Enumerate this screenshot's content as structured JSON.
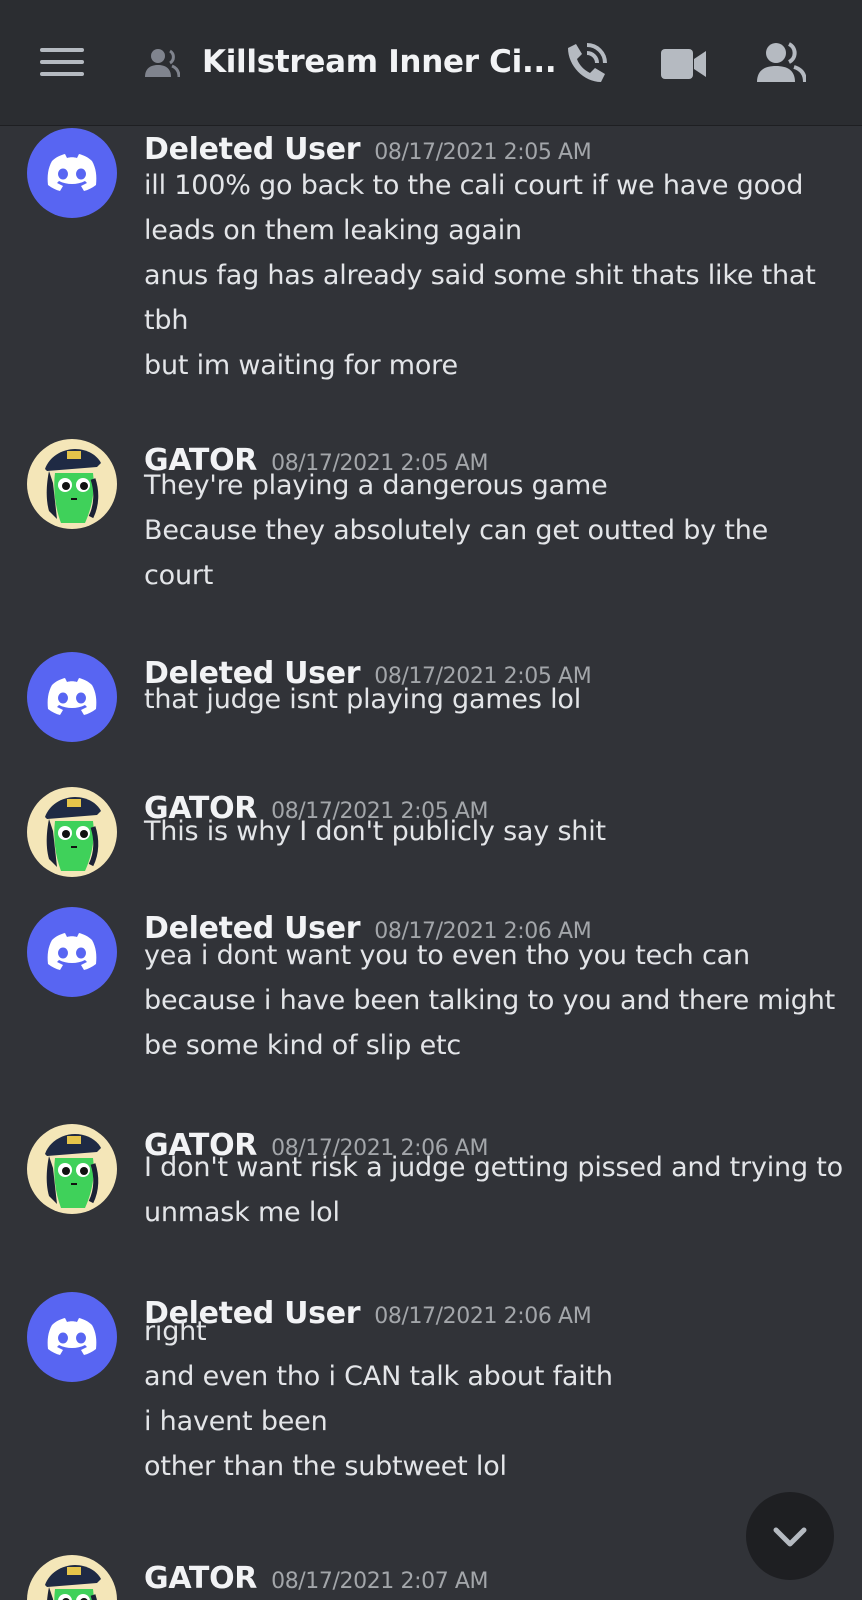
{
  "header": {
    "title": "Killstream Inner Ci...",
    "icons": [
      "menu-icon",
      "member-icon",
      "phone-call-icon",
      "video-camera-icon",
      "members-icon"
    ]
  },
  "colors": {
    "background": "#313338",
    "header": "#2b2d31",
    "blurple": "#5865f2",
    "timestamp": "#a3a6aa"
  },
  "messages": [
    {
      "author": "Deleted User",
      "time": "08/17/2021 2:05 AM",
      "avatar": "discord-logo-avatar",
      "lines": [
        "ill 100% go back to the cali court if we have good",
        "leads on them leaking again",
        "anus fag has already said some shit thats like that",
        "tbh",
        "but im waiting for more"
      ]
    },
    {
      "author": "GATOR",
      "time": "08/17/2021 2:05 AM",
      "avatar": "gator-avatar",
      "lines": [
        "They're playing a dangerous game",
        "Because they absolutely can get outted by the",
        "court"
      ]
    },
    {
      "author": "Deleted User",
      "time": "08/17/2021 2:05 AM",
      "avatar": "discord-logo-avatar",
      "lines": [
        "that judge isnt playing games lol"
      ]
    },
    {
      "author": "GATOR",
      "time": "08/17/2021 2:05 AM",
      "avatar": "gator-avatar",
      "lines": [
        "This is why I don't publicly say shit"
      ]
    },
    {
      "author": "Deleted User",
      "time": "08/17/2021 2:06 AM",
      "avatar": "discord-logo-avatar",
      "lines": [
        "yea i dont want you to even tho you tech can",
        "because i have been talking to you and there might",
        "be some kind of slip etc"
      ]
    },
    {
      "author": "GATOR",
      "time": "08/17/2021 2:06 AM",
      "avatar": "gator-avatar",
      "lines": [
        "I don't want risk a judge getting pissed and trying to",
        "unmask me lol"
      ]
    },
    {
      "author": "Deleted User",
      "time": "08/17/2021 2:06 AM",
      "avatar": "discord-logo-avatar",
      "lines": [
        "right",
        "and even tho i CAN talk about faith",
        "i havent been",
        "other than the subtweet lol"
      ]
    },
    {
      "author": "GATOR",
      "time": "08/17/2021 2:07 AM",
      "avatar": "gator-avatar",
      "lines": []
    }
  ]
}
